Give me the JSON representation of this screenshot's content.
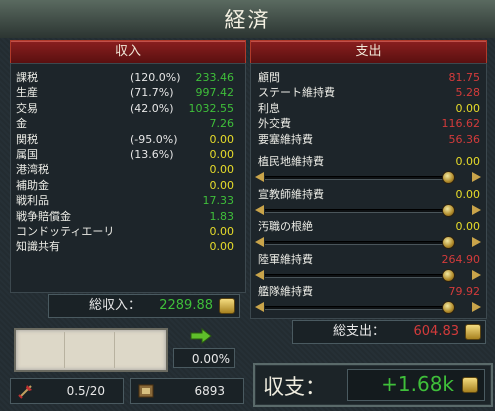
{
  "window": {
    "title": "経済"
  },
  "income": {
    "header": "収入",
    "rows": [
      {
        "label": "課税",
        "pct": "(120.0%)",
        "value": "233.46",
        "color": "green"
      },
      {
        "label": "生産",
        "pct": "(71.7%)",
        "value": "997.42",
        "color": "green"
      },
      {
        "label": "交易",
        "pct": "(42.0%)",
        "value": "1032.55",
        "color": "green"
      },
      {
        "label": "金",
        "pct": "",
        "value": "7.26",
        "color": "green"
      },
      {
        "label": "関税",
        "pct": "(-95.0%)",
        "value": "0.00",
        "color": "yellow"
      },
      {
        "label": "属国",
        "pct": "(13.6%)",
        "value": "0.00",
        "color": "yellow"
      },
      {
        "label": "港湾税",
        "pct": "",
        "value": "0.00",
        "color": "yellow"
      },
      {
        "label": "補助金",
        "pct": "",
        "value": "0.00",
        "color": "yellow"
      },
      {
        "label": "戦利品",
        "pct": "",
        "value": "17.33",
        "color": "green"
      },
      {
        "label": "戦争賠償金",
        "pct": "",
        "value": "1.83",
        "color": "green"
      },
      {
        "label": "コンドッティエーリ",
        "pct": "",
        "value": "0.00",
        "color": "yellow"
      },
      {
        "label": "知識共有",
        "pct": "",
        "value": "0.00",
        "color": "yellow"
      }
    ],
    "total_label": "総収入：",
    "total_value": "2289.88"
  },
  "expenses": {
    "header": "支出",
    "rows": [
      {
        "label": "顧問",
        "value": "81.75",
        "color": "red"
      },
      {
        "label": "ステート維持費",
        "value": "5.28",
        "color": "red"
      },
      {
        "label": "利息",
        "value": "0.00",
        "color": "yellow"
      },
      {
        "label": "外交費",
        "value": "116.62",
        "color": "red"
      },
      {
        "label": "要塞維持費",
        "value": "56.36",
        "color": "red"
      }
    ],
    "slider_rows": [
      {
        "label": "植民地維持費",
        "value": "0.00",
        "color": "yellow",
        "level": 1.0
      },
      {
        "label": "宣教師維持費",
        "value": "0.00",
        "color": "yellow",
        "level": 1.0
      },
      {
        "label": "汚職の根絶",
        "value": "0.00",
        "color": "yellow",
        "level": 1.0
      },
      {
        "label": "陸軍維持費",
        "value": "264.90",
        "color": "red",
        "level": 1.0
      },
      {
        "label": "艦隊維持費",
        "value": "79.92",
        "color": "red",
        "level": 1.0
      }
    ],
    "total_label": "総支出：",
    "total_value": "604.83"
  },
  "loan_pct": "0.00%",
  "stats": {
    "left_value": "0.5/20",
    "right_value": "6893"
  },
  "balance": {
    "label": "収支：",
    "value": "+1.68k"
  },
  "colors": {
    "green": "#3fbf3a",
    "yellow": "#e6dc2a",
    "red": "#d33b3b",
    "banner": "#7a1a1a"
  }
}
